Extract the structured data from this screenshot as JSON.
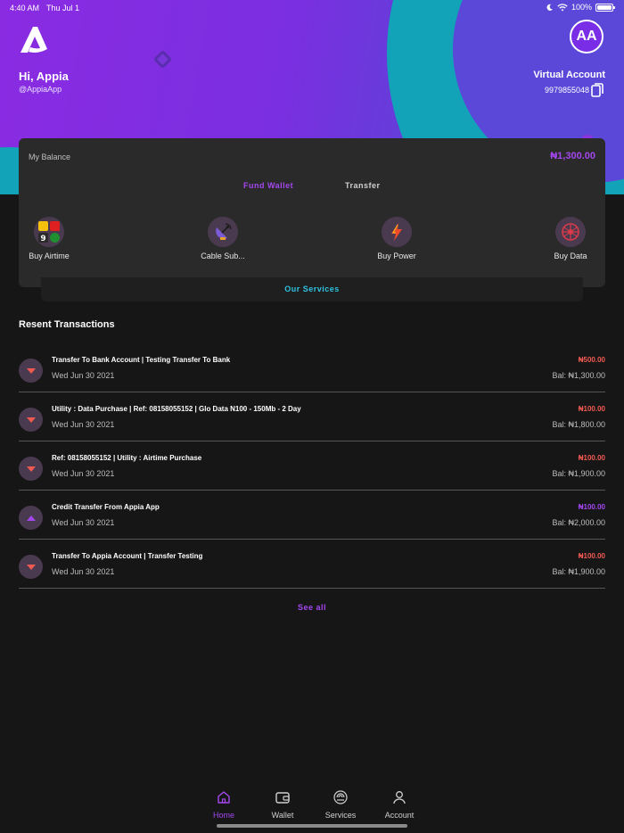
{
  "status_bar": {
    "time": "4:40 AM",
    "date": "Thu Jul 1",
    "battery": "100%"
  },
  "header": {
    "greeting": "Hi, Appia",
    "handle": "@AppiaApp",
    "avatar_initials": "AA",
    "virtual_account_title": "Virtual Account",
    "virtual_account_number": "9979855048"
  },
  "balance_card": {
    "label": "My Balance",
    "value": "₦1,300.00",
    "fund_wallet": "Fund Wallet",
    "transfer": "Transfer",
    "services": [
      {
        "label": "Buy Airtime",
        "icon": "airtime-icon"
      },
      {
        "label": "Cable Sub...",
        "icon": "satellite-dish-icon"
      },
      {
        "label": "Buy Power",
        "icon": "lightning-icon"
      },
      {
        "label": "Buy Data",
        "icon": "data-icon"
      }
    ],
    "our_services": "Our Services"
  },
  "transactions": {
    "title": "Resent Transactions",
    "items": [
      {
        "desc": "Transfer To Bank Account | Testing Transfer To Bank",
        "date": "Wed Jun 30 2021",
        "amount": "₦500.00",
        "balance": "Bal: ₦1,300.00",
        "type": "debit"
      },
      {
        "desc": "Utility : Data Purchase | Ref: 08158055152 | Glo Data N100 -  150Mb - 2 Day",
        "date": "Wed Jun 30 2021",
        "amount": "₦100.00",
        "balance": "Bal: ₦1,800.00",
        "type": "debit"
      },
      {
        "desc": "Ref: 08158055152 | Utility : Airtime Purchase",
        "date": "Wed Jun 30 2021",
        "amount": "₦100.00",
        "balance": "Bal: ₦1,900.00",
        "type": "debit"
      },
      {
        "desc": "Credit Transfer From Appia App",
        "date": "Wed Jun 30 2021",
        "amount": "₦100.00",
        "balance": "Bal: ₦2,000.00",
        "type": "credit"
      },
      {
        "desc": "Transfer To Appia Account | Transfer Testing",
        "date": "Wed Jun 30 2021",
        "amount": "₦100.00",
        "balance": "Bal: ₦1,900.00",
        "type": "debit"
      }
    ],
    "see_all": "See all"
  },
  "nav": {
    "home": "Home",
    "wallet": "Wallet",
    "services": "Services",
    "account": "Account"
  },
  "colors": {
    "accent": "#a447ef",
    "debit": "#f05a52",
    "teal": "#2ec2de",
    "background": "#161616"
  }
}
